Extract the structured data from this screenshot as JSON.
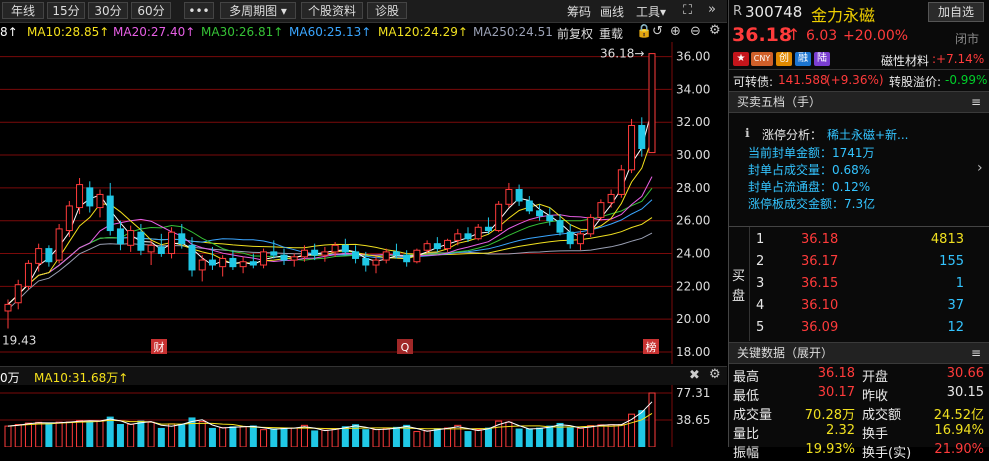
{
  "toolbar": {
    "buttons": [
      "年线",
      "15分",
      "30分",
      "60分",
      "•••",
      "多周期图 ▾",
      "个股资料",
      "诊股"
    ],
    "right_links": [
      "筹码",
      "画线",
      "工具▾"
    ]
  },
  "ma": {
    "ma5_tail": "8↑",
    "ma10": "MA10:28.85↑",
    "ma20": "MA20:27.40↑",
    "ma30": "MA30:26.81↑",
    "ma60": "MA60:25.13↑",
    "ma120": "MA120:24.29↑",
    "ma250": "MA250:24.51",
    "adjust": "前复权",
    "overlay": "重载",
    "colors": {
      "ma5": "#ffffff",
      "ma10": "#f5e11c",
      "ma20": "#e75fe5",
      "ma30": "#36c236",
      "ma60": "#3aa6ff",
      "ma120": "#f0e020",
      "ma250": "#9aa0b4"
    }
  },
  "chart_data": [
    {
      "type": "candlestick",
      "y_axis_ticks": [
        "36.00",
        "34.00",
        "32.00",
        "30.00",
        "28.00",
        "26.00",
        "24.00",
        "22.00",
        "20.00",
        "18.00"
      ],
      "ylim": [
        18,
        36.4
      ],
      "annotations": {
        "high": "36.18→",
        "low": "19.43"
      },
      "markers": [
        "财",
        "Q",
        "榜"
      ],
      "ohlc": [
        [
          20.5,
          21.2,
          19.43,
          20.9
        ],
        [
          21.0,
          22.4,
          20.6,
          22.1
        ],
        [
          22.0,
          23.6,
          21.8,
          23.4
        ],
        [
          23.4,
          24.6,
          22.9,
          24.3
        ],
        [
          24.3,
          24.5,
          23.2,
          23.5
        ],
        [
          23.6,
          25.8,
          23.4,
          25.5
        ],
        [
          25.4,
          27.2,
          25.0,
          26.9
        ],
        [
          26.8,
          28.6,
          26.4,
          28.2
        ],
        [
          28.0,
          28.4,
          26.5,
          26.9
        ],
        [
          26.8,
          27.9,
          26.2,
          27.6
        ],
        [
          27.5,
          28.3,
          25.1,
          25.4
        ],
        [
          25.5,
          26.0,
          24.2,
          24.6
        ],
        [
          24.5,
          25.7,
          24.1,
          25.4
        ],
        [
          25.3,
          25.8,
          23.9,
          24.2
        ],
        [
          24.1,
          24.8,
          23.3,
          24.5
        ],
        [
          24.4,
          25.2,
          23.8,
          24.0
        ],
        [
          24.0,
          25.6,
          23.7,
          25.3
        ],
        [
          25.2,
          25.8,
          24.3,
          24.6
        ],
        [
          24.5,
          25.0,
          22.6,
          23.0
        ],
        [
          23.0,
          23.9,
          22.3,
          23.6
        ],
        [
          23.6,
          24.4,
          23.0,
          23.3
        ],
        [
          23.2,
          23.9,
          22.6,
          23.7
        ],
        [
          23.7,
          24.2,
          23.0,
          23.2
        ],
        [
          23.2,
          23.8,
          22.8,
          23.5
        ],
        [
          23.5,
          24.0,
          23.1,
          23.3
        ],
        [
          23.3,
          24.3,
          23.1,
          24.1
        ],
        [
          24.1,
          24.8,
          23.7,
          23.9
        ],
        [
          23.9,
          24.3,
          23.3,
          23.6
        ],
        [
          23.6,
          24.0,
          23.2,
          23.8
        ],
        [
          23.8,
          24.5,
          23.5,
          24.2
        ],
        [
          24.2,
          24.6,
          23.6,
          23.9
        ],
        [
          23.9,
          24.4,
          23.5,
          24.1
        ],
        [
          24.1,
          24.7,
          23.8,
          24.5
        ],
        [
          24.5,
          24.9,
          23.9,
          24.1
        ],
        [
          24.1,
          24.5,
          23.4,
          23.7
        ],
        [
          23.7,
          24.1,
          22.9,
          23.3
        ],
        [
          23.3,
          23.8,
          22.8,
          23.6
        ],
        [
          23.6,
          24.3,
          23.4,
          24.1
        ],
        [
          24.1,
          24.6,
          23.7,
          23.9
        ],
        [
          23.9,
          24.2,
          23.2,
          23.5
        ],
        [
          23.5,
          24.3,
          23.4,
          24.2
        ],
        [
          24.2,
          24.8,
          24.0,
          24.6
        ],
        [
          24.6,
          25.0,
          24.1,
          24.3
        ],
        [
          24.3,
          24.9,
          24.1,
          24.8
        ],
        [
          24.8,
          25.5,
          24.5,
          25.2
        ],
        [
          25.2,
          25.6,
          24.7,
          24.9
        ],
        [
          24.9,
          25.8,
          24.8,
          25.6
        ],
        [
          25.6,
          26.2,
          25.2,
          25.4
        ],
        [
          25.4,
          27.2,
          25.3,
          27.0
        ],
        [
          27.0,
          28.3,
          26.8,
          27.9
        ],
        [
          27.9,
          28.2,
          26.9,
          27.2
        ],
        [
          27.2,
          27.5,
          26.4,
          26.6
        ],
        [
          26.6,
          27.0,
          26.0,
          26.3
        ],
        [
          26.3,
          26.8,
          25.7,
          26.0
        ],
        [
          26.0,
          26.4,
          25.1,
          25.3
        ],
        [
          25.3,
          25.8,
          24.3,
          24.6
        ],
        [
          24.6,
          25.4,
          24.2,
          25.2
        ],
        [
          25.2,
          26.4,
          25.0,
          26.2
        ],
        [
          26.2,
          27.3,
          26.0,
          27.1
        ],
        [
          27.1,
          27.9,
          26.8,
          27.6
        ],
        [
          27.6,
          29.4,
          27.4,
          29.1
        ],
        [
          29.1,
          32.2,
          28.9,
          31.8
        ],
        [
          31.8,
          32.3,
          29.9,
          30.4
        ],
        [
          30.15,
          36.18,
          30.17,
          36.18
        ]
      ],
      "volume_axis": [
        "77.31",
        "38.65"
      ]
    }
  ],
  "volume": {
    "tail": "0万",
    "ma10": "MA10:31.68万↑"
  },
  "stock": {
    "prefix": "R",
    "code": "300748",
    "name": "金力永磁",
    "add_button": "加自选",
    "price": "36.18",
    "arrow": "↑",
    "change": "6.03",
    "change_pct": "+20.00%",
    "status": "闭市",
    "badges": [
      "CNY",
      "创",
      "融",
      "陆"
    ],
    "sector_label": "磁性材料",
    "sector_value": ":+7.14%",
    "convertible_label": "可转债:",
    "convertible_value": "141.588",
    "convertible_change": "(+9.36%)",
    "premium_label": "转股溢价:",
    "premium_value": "-0.99%"
  },
  "orderbook": {
    "title": "买卖五档（手）",
    "analysis_label": "涨停分析：",
    "analysis_value": "稀土永磁+新...",
    "lines": [
      "当前封单金额：1741万",
      "封单占成交量：0.68%",
      "封单占流通盘：0.12%",
      "涨停板成交金额：7.3亿"
    ],
    "side_label_1": "买",
    "side_label_2": "盘",
    "bids": [
      {
        "level": "1",
        "price": "36.18",
        "volume": "4813"
      },
      {
        "level": "2",
        "price": "36.17",
        "volume": "155"
      },
      {
        "level": "3",
        "price": "36.15",
        "volume": "1"
      },
      {
        "level": "4",
        "price": "36.10",
        "volume": "37"
      },
      {
        "level": "5",
        "price": "36.09",
        "volume": "12"
      }
    ]
  },
  "keydata": {
    "title": "关键数据（展开）",
    "rows": [
      {
        "l1": "最高",
        "v1": "36.18",
        "l2": "开盘",
        "v2": "30.66",
        "c1": "red",
        "c2": "red"
      },
      {
        "l1": "最低",
        "v1": "30.17",
        "l2": "昨收",
        "v2": "30.15",
        "c1": "red",
        "c2": "white"
      },
      {
        "l1": "成交量",
        "v1": "70.28万",
        "l2": "成交额",
        "v2": "24.52亿",
        "c1": "yellow",
        "c2": "yellow"
      },
      {
        "l1": "量比",
        "v1": "2.32",
        "l2": "换手",
        "v2": "16.94%",
        "c1": "yellow",
        "c2": "yellow"
      },
      {
        "l1": "振幅",
        "v1": "19.93%",
        "l2": "换手(实)",
        "v2": "21.90%",
        "c1": "yellow",
        "c2": "red"
      }
    ]
  }
}
